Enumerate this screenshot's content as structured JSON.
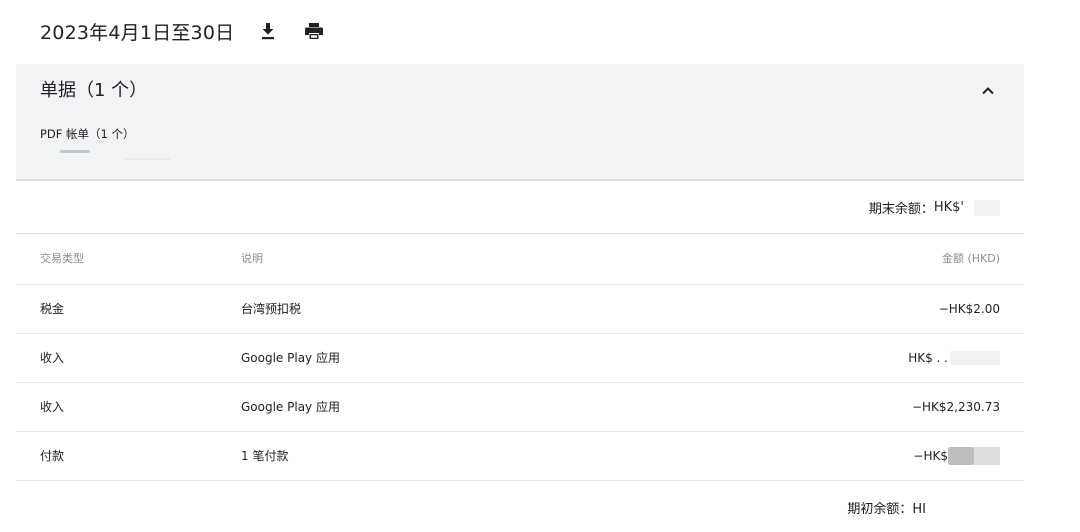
{
  "header": {
    "title": "2023年4月1日至30日",
    "download_icon": "download-icon",
    "print_icon": "print-icon"
  },
  "documents": {
    "title": "单据（1 个）",
    "collapse_icon": "chevron-up-icon",
    "tab_label": "PDF 帐单（1 个）"
  },
  "closing_balance": {
    "label": "期末余额：",
    "value": "HK$'"
  },
  "table": {
    "headers": {
      "type": "交易类型",
      "description": "说明",
      "amount": "金额 (HKD)"
    },
    "rows": [
      {
        "type": "税金",
        "description": "台湾预扣税",
        "amount": "−HK$2.00"
      },
      {
        "type": "收入",
        "description": "Google Play 应用",
        "amount": "HK$ . ."
      },
      {
        "type": "收入",
        "description": "Google Play 应用",
        "amount": "−HK$2,230.73"
      },
      {
        "type": "付款",
        "description": "1 笔付款",
        "amount": "−HK$"
      }
    ]
  },
  "opening_balance": {
    "label": "期初余额：",
    "value": "HI"
  }
}
